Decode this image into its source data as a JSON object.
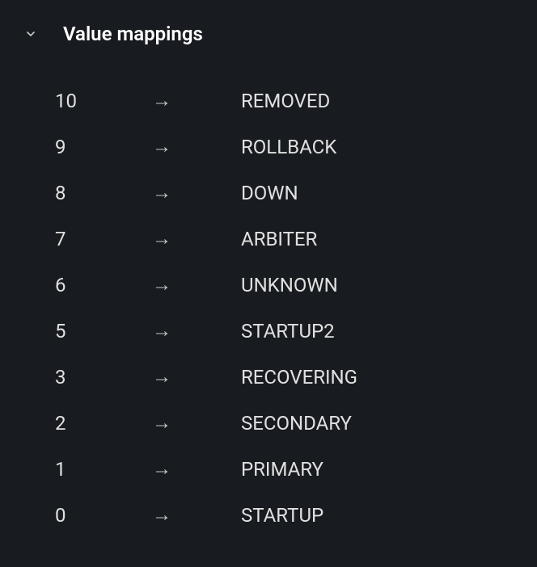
{
  "section": {
    "title": "Value mappings",
    "expanded": true
  },
  "arrow_symbol": "→",
  "mappings": [
    {
      "key": "10",
      "value": "REMOVED"
    },
    {
      "key": "9",
      "value": "ROLLBACK"
    },
    {
      "key": "8",
      "value": "DOWN"
    },
    {
      "key": "7",
      "value": "ARBITER"
    },
    {
      "key": "6",
      "value": "UNKNOWN"
    },
    {
      "key": "5",
      "value": "STARTUP2"
    },
    {
      "key": "3",
      "value": "RECOVERING"
    },
    {
      "key": "2",
      "value": "SECONDARY"
    },
    {
      "key": "1",
      "value": "PRIMARY"
    },
    {
      "key": "0",
      "value": "STARTUP"
    }
  ]
}
